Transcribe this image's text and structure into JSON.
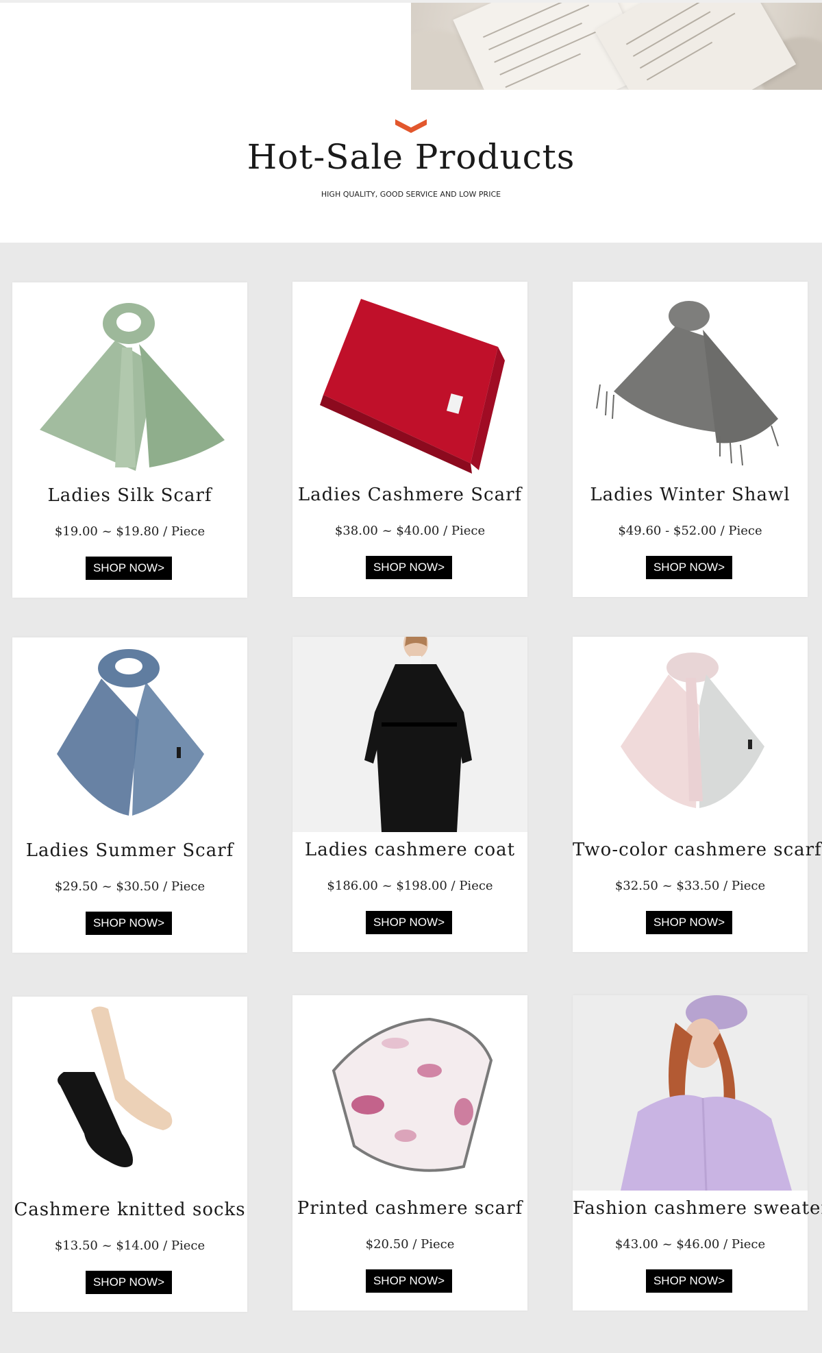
{
  "header": {
    "title": "Hot-Sale Products",
    "subtitle": "HIGH QUALITY, GOOD SERVICE AND LOW PRICE",
    "accent_color": "#e2572d",
    "hero_icon": "open-book-image"
  },
  "products": [
    {
      "name": "Ladies Silk Scarf",
      "price": "$19.00 ~ $19.80 / Piece",
      "button": "SHOP NOW>",
      "image": "sage-green-silk-scarf"
    },
    {
      "name": "Ladies Cashmere Scarf",
      "price": "$38.00 ~ $40.00 / Piece",
      "button": "SHOP NOW>",
      "image": "red-folded-cashmere-scarf"
    },
    {
      "name": "Ladies Winter Shawl",
      "price": "$49.60 - $52.00 / Piece",
      "button": "SHOP NOW>",
      "image": "grey-fringed-shawl"
    },
    {
      "name": "Ladies Summer Scarf",
      "price": "$29.50 ~ $30.50 / Piece",
      "button": "SHOP NOW>",
      "image": "blue-sheer-scarf"
    },
    {
      "name": "Ladies cashmere coat",
      "price": "$186.00 ~ $198.00 / Piece",
      "button": "SHOP NOW>",
      "image": "black-long-coat-model"
    },
    {
      "name": "Two-color cashmere scarf",
      "price": "$32.50 ~ $33.50 / Piece",
      "button": "SHOP NOW>",
      "image": "pink-grey-scarf"
    },
    {
      "name": "Cashmere knitted socks",
      "price": "$13.50 ~ $14.00 / Piece",
      "button": "SHOP NOW>",
      "image": "black-and-beige-socks"
    },
    {
      "name": "Printed cashmere scarf",
      "price": "$20.50 / Piece",
      "button": "SHOP NOW>",
      "image": "printed-floral-scarf"
    },
    {
      "name": "Fashion cashmere sweater",
      "price": "$43.00 ~ $46.00 / Piece",
      "button": "SHOP NOW>",
      "image": "lavender-sweater-model"
    }
  ]
}
